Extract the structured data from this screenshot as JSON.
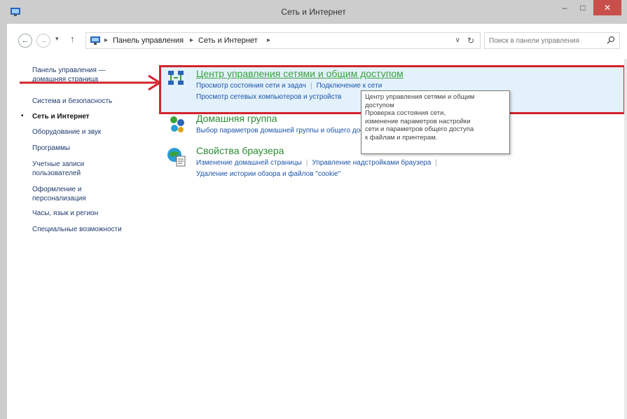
{
  "window": {
    "title": "Сеть и Интернет",
    "minimize": "–",
    "maximize": "□",
    "close": "✕"
  },
  "toolbar": {
    "back": "←",
    "forward": "→",
    "recent": "▾",
    "up": "↑"
  },
  "address": {
    "crumbs": [
      "Панель управления",
      "Сеть и Интернет"
    ],
    "separator": "▸",
    "dropdown": "∨",
    "refresh": "↻"
  },
  "search": {
    "placeholder": "Поиск в панели управления"
  },
  "leftnav": {
    "items": [
      {
        "label": "Панель управления —",
        "label2": "домашняя страница",
        "current": false
      },
      {
        "label": "Система и безопасность",
        "current": false
      },
      {
        "label": "Сеть и Интернет",
        "current": true
      },
      {
        "label": "Оборудование и звук",
        "current": false
      },
      {
        "label": "Программы",
        "current": false
      },
      {
        "label": "Учетные записи",
        "label2": "пользователей",
        "current": false
      },
      {
        "label": "Оформление и",
        "label2": "персонализация",
        "current": false
      },
      {
        "label": "Часы, язык и регион",
        "current": false
      },
      {
        "label": "Специальные возможности",
        "current": false
      }
    ],
    "bullet": "•"
  },
  "categories": [
    {
      "title": "Центр управления сетями и общим доступом",
      "icon": "network-center-icon",
      "links_row1": [
        "Просмотр состояния сети и задач",
        "Подключение к сети"
      ],
      "links_row2": [
        "Просмотр сетевых компьютеров и устройств"
      ]
    },
    {
      "title": "Домашняя группа",
      "icon": "homegroup-icon",
      "links_row1": [
        "Выбор параметров домашней группы и общего доступа"
      ]
    },
    {
      "title": "Свойства браузера",
      "icon": "browser-options-icon",
      "links_row1": [
        "Изменение домашней страницы",
        "Управление надстройками браузера"
      ],
      "links_row2": [
        "Удаление истории обзора и файлов \"cookie\""
      ]
    }
  ],
  "tooltip": {
    "lines": [
      "Центр управления сетями и общим",
      "доступом",
      "Проверка состояния сети,",
      "изменение параметров настройки",
      "сети и параметров общего доступа",
      "к файлам и принтерам."
    ]
  },
  "colors": {
    "highlight_border": "#d3232d",
    "highlight_bg": "#e3f1fb",
    "category_title": "#2c8b34",
    "link": "#1d54a8",
    "close_button": "#c7504b"
  }
}
